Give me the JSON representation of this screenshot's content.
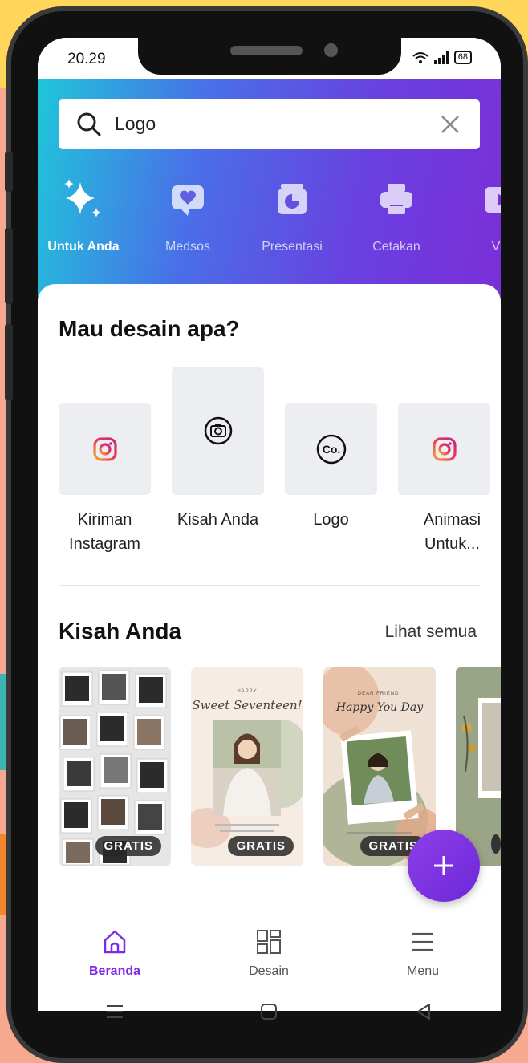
{
  "status_bar": {
    "time": "20.29",
    "battery": "68"
  },
  "search": {
    "value": "Logo"
  },
  "categories": [
    {
      "label": "Untuk Anda",
      "icon": "sparkle-icon"
    },
    {
      "label": "Medsos",
      "icon": "heart-chat-icon"
    },
    {
      "label": "Presentasi",
      "icon": "presentation-icon"
    },
    {
      "label": "Cetakan",
      "icon": "printer-icon"
    },
    {
      "label": "Vid",
      "icon": "video-icon"
    }
  ],
  "design_section": {
    "title": "Mau desain apa?",
    "types": [
      {
        "label": "Kiriman Instagram",
        "icon": "instagram-icon"
      },
      {
        "label": "Kisah Anda",
        "icon": "camera-icon"
      },
      {
        "label": "Logo",
        "icon": "logo-co-icon"
      },
      {
        "label": "Animasi Untuk...",
        "icon": "instagram-icon"
      }
    ]
  },
  "stories_section": {
    "title": "Kisah Anda",
    "see_all": "Lihat semua",
    "templates": [
      {
        "badge": "GRATIS"
      },
      {
        "badge": "GRATIS",
        "script_text": "Sweet Seventeen!",
        "small_text": "HAPPY"
      },
      {
        "badge": "GRATIS",
        "script_text": "Happy You Day",
        "small_text": "DEAR FRIEND,"
      }
    ]
  },
  "bottom_nav": {
    "items": [
      {
        "label": "Beranda",
        "icon": "home-icon"
      },
      {
        "label": "Desain",
        "icon": "grid-icon"
      },
      {
        "label": "Menu",
        "icon": "menu-icon"
      }
    ]
  },
  "colors": {
    "accent": "#7d2ae8",
    "instagram_start": "#f7a534",
    "instagram_end": "#c9277c"
  }
}
